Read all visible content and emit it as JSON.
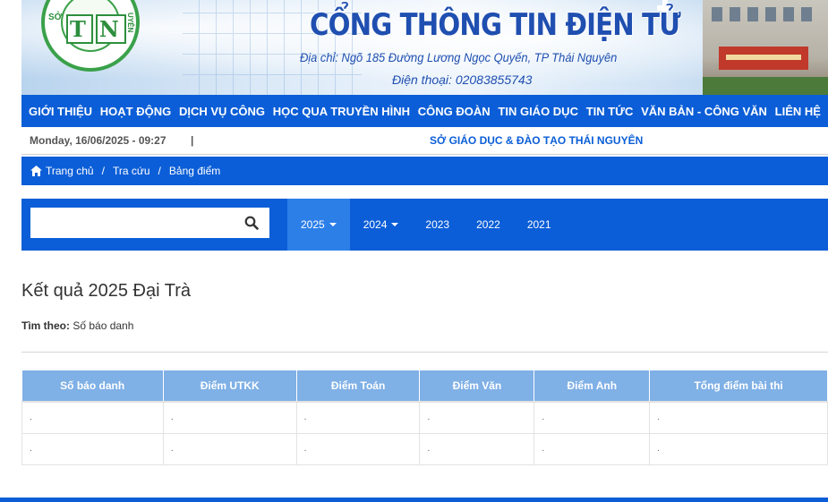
{
  "banner": {
    "logo_letters": [
      "T",
      "N"
    ],
    "logo_side_left": "SỞ",
    "logo_side_right": "UYÊN",
    "title": "CỔNG THÔNG TIN ĐIỆN TỬ",
    "address": "Địa chỉ: Ngõ 185 Đường Lương Ngọc Quyến, TP Thái Nguyên",
    "phone": "Điện thoại: 02083855743"
  },
  "nav": {
    "items": [
      "GIỚI THIỆU",
      "HOẠT ĐỘNG",
      "DỊCH VỤ CÔNG",
      "HỌC QUA TRUYỀN HÌNH",
      "CÔNG ĐOÀN",
      "TIN GIÁO DỤC",
      "TIN TỨC",
      "VĂN BẢN - CÔNG VĂN",
      "LIÊN HỆ"
    ]
  },
  "info": {
    "datetime": "Monday, 16/06/2025 - 09:27",
    "separator": "|",
    "organization": "SỞ GIÁO DỤC & ĐÀO TẠO THÁI NGUYÊN"
  },
  "breadcrumb": {
    "home": "Trang chủ",
    "lookup": "Tra cứu",
    "current": "Bảng điểm",
    "separator": "/"
  },
  "search": {
    "value": "",
    "placeholder": ""
  },
  "years": [
    {
      "label": "2025",
      "dropdown": true,
      "active": true
    },
    {
      "label": "2024",
      "dropdown": true,
      "active": false
    },
    {
      "label": "2023",
      "dropdown": false,
      "active": false
    },
    {
      "label": "2022",
      "dropdown": false,
      "active": false
    },
    {
      "label": "2021",
      "dropdown": false,
      "active": false
    }
  ],
  "result": {
    "title": "Kết quả 2025 Đại Trà",
    "search_by_label": "Tìm theo:",
    "search_by_value": "Số báo danh"
  },
  "table": {
    "headers": [
      "Số báo danh",
      "Điểm UTKK",
      "Điểm Toán",
      "Điểm Văn",
      "Điểm Anh",
      "Tổng điểm bài thi"
    ],
    "rows": [
      [
        ".",
        ".",
        ".",
        ".",
        ".",
        "."
      ],
      [
        ".",
        ".",
        ".",
        ".",
        ".",
        "."
      ]
    ]
  },
  "colors": {
    "primary_blue": "#0b5ed7",
    "active_tab": "#2d7fe8",
    "table_header": "#7fb0e6",
    "logo_green": "#3aa14a"
  }
}
